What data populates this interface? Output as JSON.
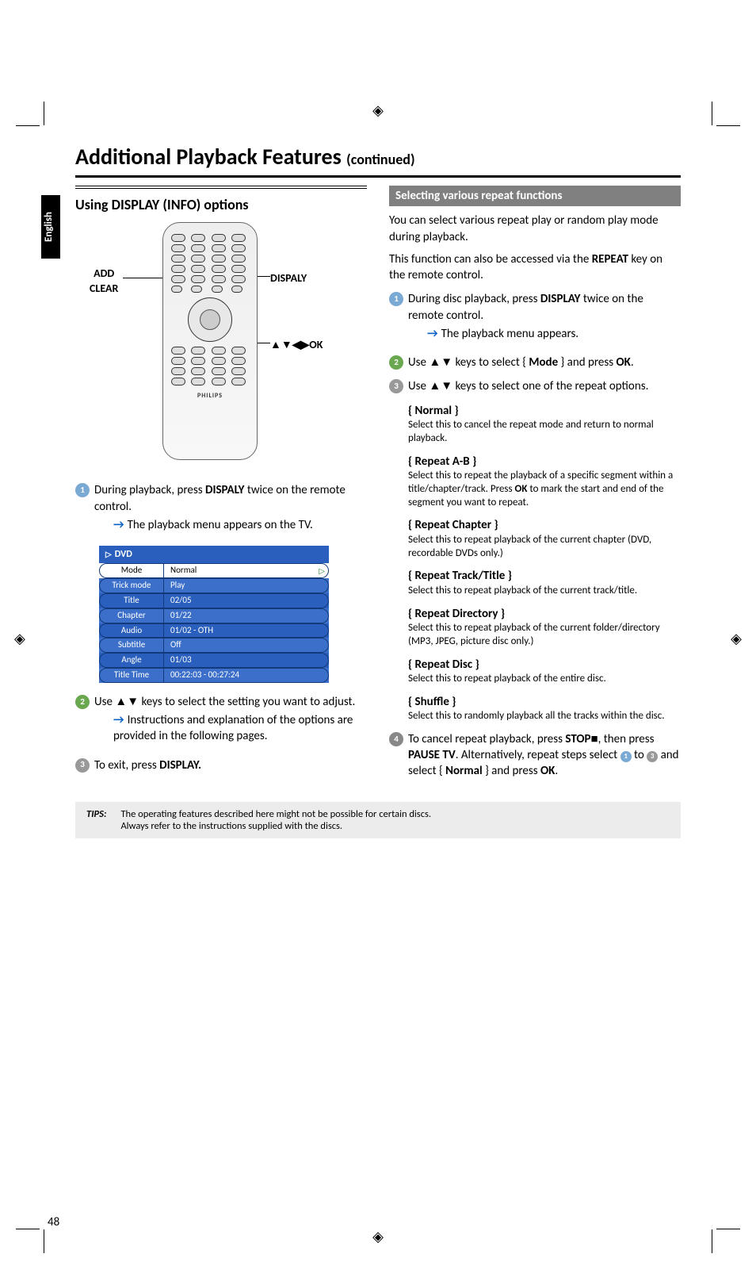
{
  "page": {
    "title_main": "Additional Playback Features ",
    "title_cont": "(continued)",
    "tab": "English",
    "page_number": "48"
  },
  "left": {
    "section_title": "Using DISPLAY (INFO) options",
    "callout_add_line1": "ADD",
    "callout_add_line2": "CLEAR",
    "callout_display": "DISPALY",
    "callout_ok_pre": "▲▼◀▶",
    "callout_ok": "OK",
    "remote_brand": "PHILIPS",
    "step1_a": "During playback, press ",
    "step1_b": "DISPALY",
    "step1_c": " twice on the remote control.",
    "step1_res": "The playback menu appears on the TV.",
    "osd_title": "DVD",
    "osd_rows": [
      {
        "l": "Mode",
        "r": "Normal",
        "sel": true
      },
      {
        "l": "Trick mode",
        "r": "Play"
      },
      {
        "l": "Title",
        "r": "02/05"
      },
      {
        "l": "Chapter",
        "r": "01/22"
      },
      {
        "l": "Audio",
        "r": "01/02 - OTH"
      },
      {
        "l": "Subtitle",
        "r": "Off"
      },
      {
        "l": "Angle",
        "r": "01/03"
      },
      {
        "l": "Title Time",
        "r": "00:22:03 - 00:27:24"
      }
    ],
    "step2_a": "Use ",
    "step2_keys": "▲▼",
    "step2_b": " keys to select the setting you want to adjust.",
    "step2_res": "Instructions and explanation of the options are provided in the following pages.",
    "step3_a": "To exit, press ",
    "step3_b": "DISPLAY."
  },
  "right": {
    "banner": "Selecting various repeat functions",
    "p1": "You can select various repeat play or random play mode during playback.",
    "p2_a": "This function can also be accessed via the ",
    "p2_b": "REPEAT",
    "p2_c": " key on the remote control.",
    "s1_a": "During disc playback, press ",
    "s1_b": "DISPLAY",
    "s1_c": " twice on the remote control.",
    "s1_res": "The playback menu appears.",
    "s2_a": "Use ",
    "s2_keys": "▲▼",
    "s2_b": " keys to select { ",
    "s2_mode": "Mode",
    "s2_c": " } and press ",
    "s2_ok": "OK",
    "s2_d": ".",
    "s3_a": "Use ",
    "s3_keys": "▲▼",
    "s3_b": " keys to select one of the repeat options.",
    "opts": [
      {
        "h": "{ Normal }",
        "b": "Select this to cancel the repeat mode and return to normal playback."
      },
      {
        "h": "{ Repeat A-B }",
        "b_pre": "Select this to repeat the playback of a specific segment within a title/chapter/track. Press ",
        "b_key": "OK",
        "b_post": " to mark the start and end of the segment you want to repeat."
      },
      {
        "h": "{ Repeat Chapter }",
        "b": "Select this to repeat playback of the current chapter (DVD, recordable DVDs only.)"
      },
      {
        "h": "{ Repeat Track/Title }",
        "b": "Select this to repeat playback of the current track/title."
      },
      {
        "h": "{ Repeat Directory }",
        "b": "Select this to repeat playback of the current folder/directory (MP3, JPEG, picture disc only.)"
      },
      {
        "h": "{ Repeat Disc }",
        "b": "Select this to repeat playback of the entire disc."
      },
      {
        "h": "{ Shuffle }",
        "b": "Select this to randomly playback all the tracks within the disc."
      }
    ],
    "s4_a": "To cancel repeat playback, press ",
    "s4_b": "STOP",
    "s4_stop_sym": "■",
    "s4_c": ", then press ",
    "s4_d": "PAUSE TV",
    "s4_e": ". Alternatively, repeat steps select ",
    "s4_f": " to ",
    "s4_g": " and select { ",
    "s4_h": "Normal",
    "s4_i": " } and press ",
    "s4_j": "OK",
    "s4_k": "."
  },
  "tips": {
    "label": "TIPS:",
    "line1": "The operating features described here might not be possible for certain discs.",
    "line2": "Always refer to the instructions supplied with the discs."
  }
}
